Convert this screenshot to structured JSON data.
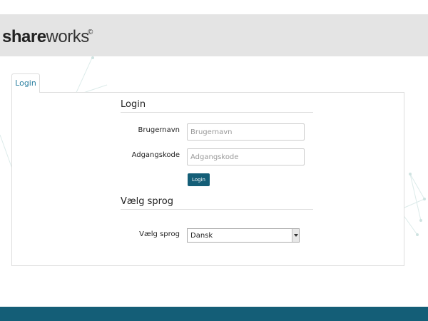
{
  "brand": {
    "logo_bold": "share",
    "logo_light": "works",
    "logo_mark": "©"
  },
  "tabs": [
    {
      "label": "Login"
    }
  ],
  "login_section": {
    "title": "Login",
    "username": {
      "label": "Brugernavn",
      "placeholder": "Brugernavn",
      "value": ""
    },
    "password": {
      "label": "Adgangskode",
      "placeholder": "Adgangskode",
      "value": ""
    },
    "submit_label": "Login"
  },
  "language_section": {
    "title": "Vælg sprog",
    "label": "Vælg sprog",
    "selected": "Dansk"
  },
  "colors": {
    "header_bg": "#e4e4e4",
    "accent": "#145e77",
    "tab_text": "#2a7fa0"
  }
}
